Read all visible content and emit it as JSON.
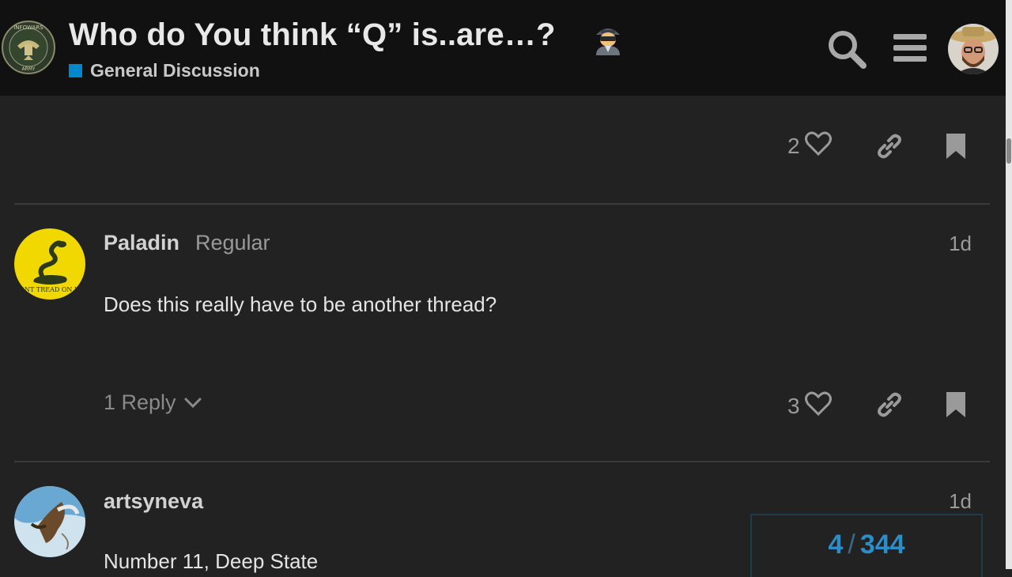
{
  "topic": {
    "title": "Who do You think “Q” is..are…?",
    "title_emoji": "spy-emoji",
    "category": "General Discussion",
    "category_color": "#0088cc"
  },
  "site": {
    "logo_icon": "infowars-army-seal-logo",
    "logo_text_top": "INFOWARS",
    "logo_text_bottom": "ARMY"
  },
  "header_controls": {
    "search_icon": "search-icon",
    "menu_icon": "hamburger-menu-icon",
    "current_user_avatar": "avatar"
  },
  "posts": [
    {
      "likes": "2",
      "actions": [
        "heart-icon",
        "link-icon",
        "bookmark-icon"
      ]
    },
    {
      "username": "Paladin",
      "user_title": "Regular",
      "date": "1d",
      "avatar_text": "DONT TREAD ON ME",
      "body": "Does this really have to be another thread?",
      "replies": "1 Reply",
      "likes": "3",
      "actions": [
        "heart-icon",
        "link-icon",
        "bookmark-icon"
      ]
    },
    {
      "username": "artsyneva",
      "date": "1d",
      "body": "Number 11, Deep State"
    }
  ],
  "progress": {
    "current": "4",
    "separator": "/",
    "total": "344"
  },
  "colors": {
    "background": "#222222",
    "header": "#111111",
    "accent": "#2b8ec9"
  }
}
